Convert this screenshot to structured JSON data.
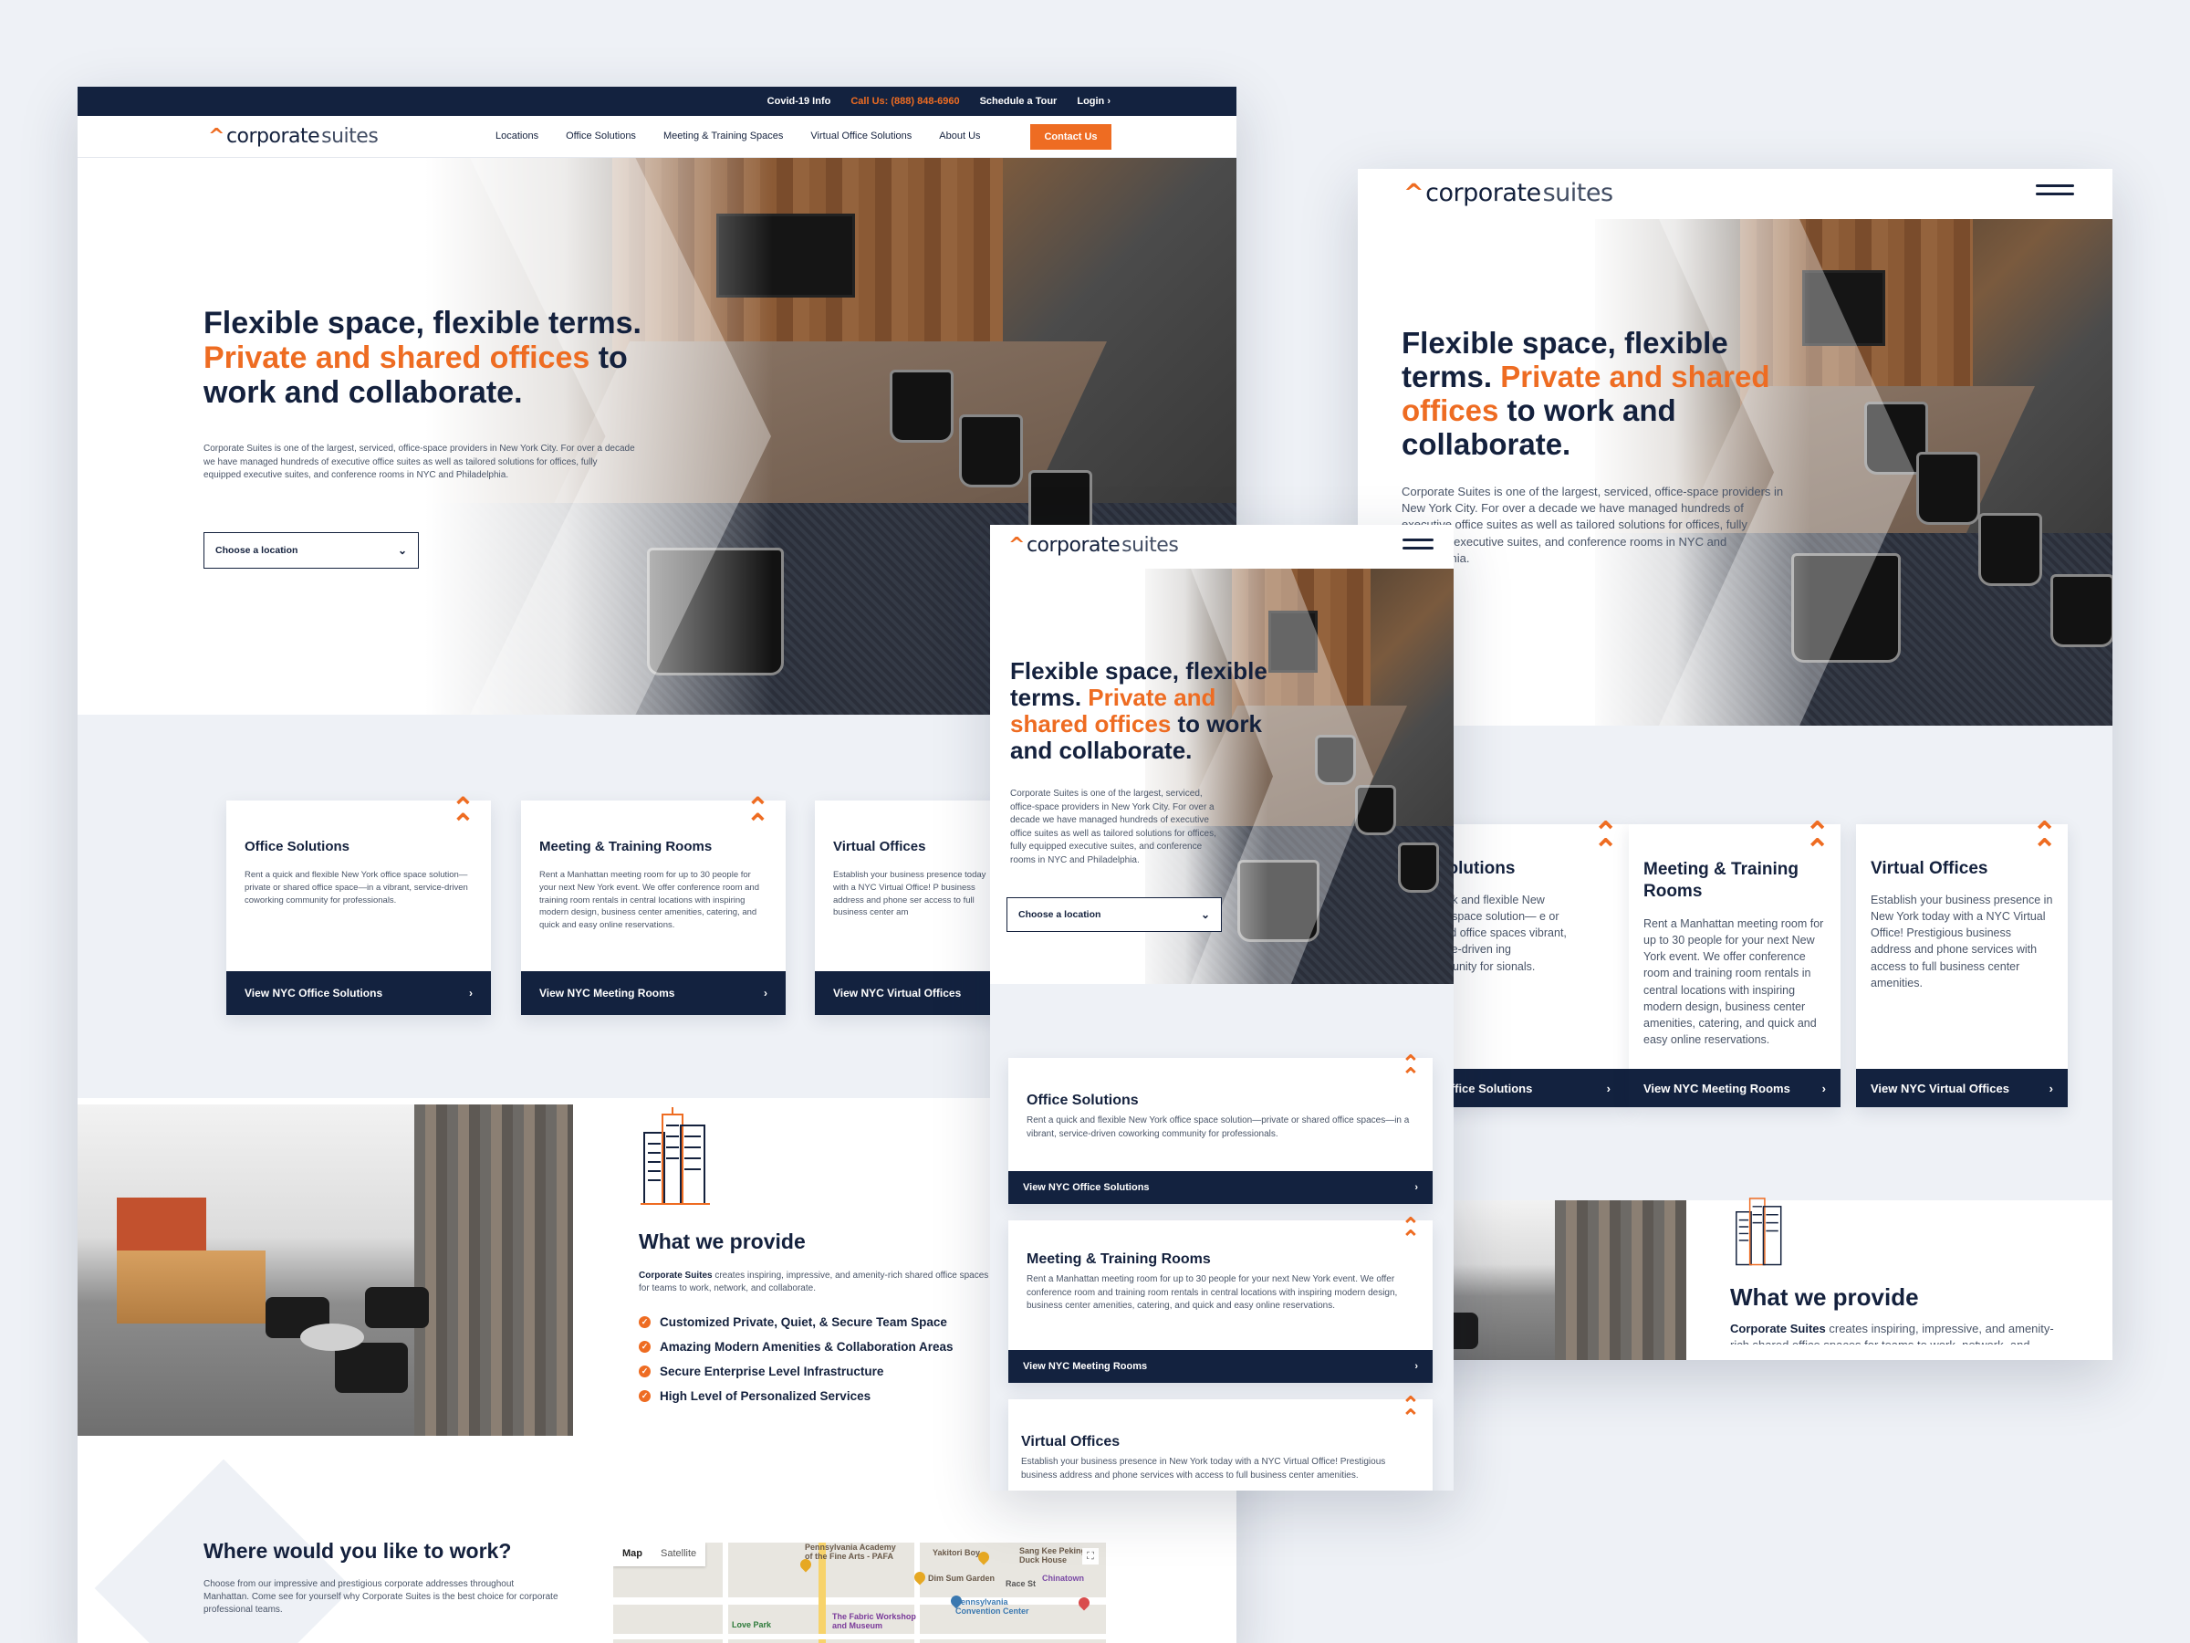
{
  "brand": {
    "logo_mark": "^",
    "logo_word_1": "corporate",
    "logo_word_2": "suites"
  },
  "colors": {
    "navy": "#13223f",
    "orange": "#ee6c22",
    "text": "#14213d",
    "background": "#eef1f6"
  },
  "topbar": {
    "covid": "Covid-19 Info",
    "call": "Call Us: (888) 848-6960",
    "tour": "Schedule a Tour",
    "login": "Login ›"
  },
  "nav": {
    "items": [
      "Locations",
      "Office Solutions",
      "Meeting & Training Spaces",
      "Virtual Office Solutions",
      "About Us"
    ],
    "contact": "Contact Us"
  },
  "hero": {
    "line1": "Flexible space, flexible terms.",
    "highlight": "Private and shared offices",
    "line2_rest": " to",
    "line3": "work and collaborate.",
    "tablet_a": "Flexible space, flexible",
    "tablet_b": "terms.",
    "tablet_c": "Private and shared",
    "tablet_d": "offices",
    "tablet_e": " to work and",
    "tablet_f": "collaborate.",
    "mobile_a": "Flexible space, flexible",
    "mobile_b": "terms.",
    "mobile_c": " Private and",
    "mobile_d": "shared offices",
    "mobile_e": " to work",
    "mobile_f": "and collaborate.",
    "body": "Corporate Suites is one of the largest, serviced, office-space providers in New York City. For over a decade we have managed hundreds of executive office suites as well as tailored solutions for offices, fully equipped executive suites, and conference rooms in NYC and Philadelphia.",
    "select_label": "Choose a location",
    "select_partial": "se a location"
  },
  "cards": [
    {
      "title": "Office Solutions",
      "desc": "Rent a quick and flexible New York office space solution—private or shared office space—in a vibrant, service-driven coworking community for professionals.",
      "cta": "View NYC Office Solutions",
      "mobile_desc": "Rent a quick and flexible New York office space solution—private or shared office spaces—in a vibrant, service-driven coworking community for professionals.",
      "tablet_title_partial": "e Solutions",
      "tablet_desc_partial": "a quick and flexible New office space solution— e or shared office spaces vibrant, service-driven ing community for sionals.",
      "tablet_cta_partial": "YC Office Solutions"
    },
    {
      "title": "Meeting & Training Rooms",
      "desc": "Rent a Manhattan meeting room for up to 30 people for your next New York event. We offer conference room and training room rentals in central locations with inspiring modern design, business center amenities, catering, and quick and easy online reservations.",
      "cta": "View NYC Meeting Rooms",
      "mobile_desc": "Rent a Manhattan meeting room for up to 30 people for your next New York event. We offer conference room and training room rentals in central locations with inspiring modern design, business center amenities, catering, and quick and easy online reservations.",
      "tablet_title_1": "Meeting & Training",
      "tablet_title_2": "Rooms"
    },
    {
      "title": "Virtual Offices",
      "desc": "Establish your business presence today with a NYC Virtual Office! Prestigious business address and phone services with access to full business center amenities.",
      "desc_partial": "Establish your business presence today with a NYC Virtual Office! P business address and phone ser access to full business center am",
      "cta": "View NYC Virtual Offices",
      "mobile_desc": "Establish your business presence in New York today with a NYC Virtual Office! Prestigious business address and phone services with access to full business center amenities.",
      "tablet_desc": "Establish your business presence in New York today with a NYC Virtual Office! Prestigious business address and phone services with access to full business center amenities."
    }
  ],
  "provide": {
    "title": "What we provide",
    "brand": "Corporate Suites",
    "body": " creates inspiring, impressive, and amenity-rich shared office spaces for teams to work, network, and collaborate.",
    "bullets": [
      "Customized Private, Quiet, & Secure Team Space",
      "Amazing Modern Amenities & Collaboration Areas",
      "Secure Enterprise Level Infrastructure",
      "High Level of Personalized Services"
    ]
  },
  "where": {
    "title": "Where would you like to work?",
    "body": "Choose from our impressive and prestigious corporate addresses throughout Manhattan. Come see for yourself why Corporate Suites is the best choice for corporate professional teams."
  },
  "map": {
    "tab_map": "Map",
    "tab_satellite": "Satellite",
    "labels": [
      "Pennsylvania Academy of the Fine Arts - PAFA",
      "Yakitori Boy",
      "Sang Kee Peking Duck House",
      "Chinatown",
      "Dim Sum Garden",
      "Pennsylvania Convention Center",
      "The Fabric Workshop and Museum",
      "Love Park",
      "Race St"
    ]
  }
}
